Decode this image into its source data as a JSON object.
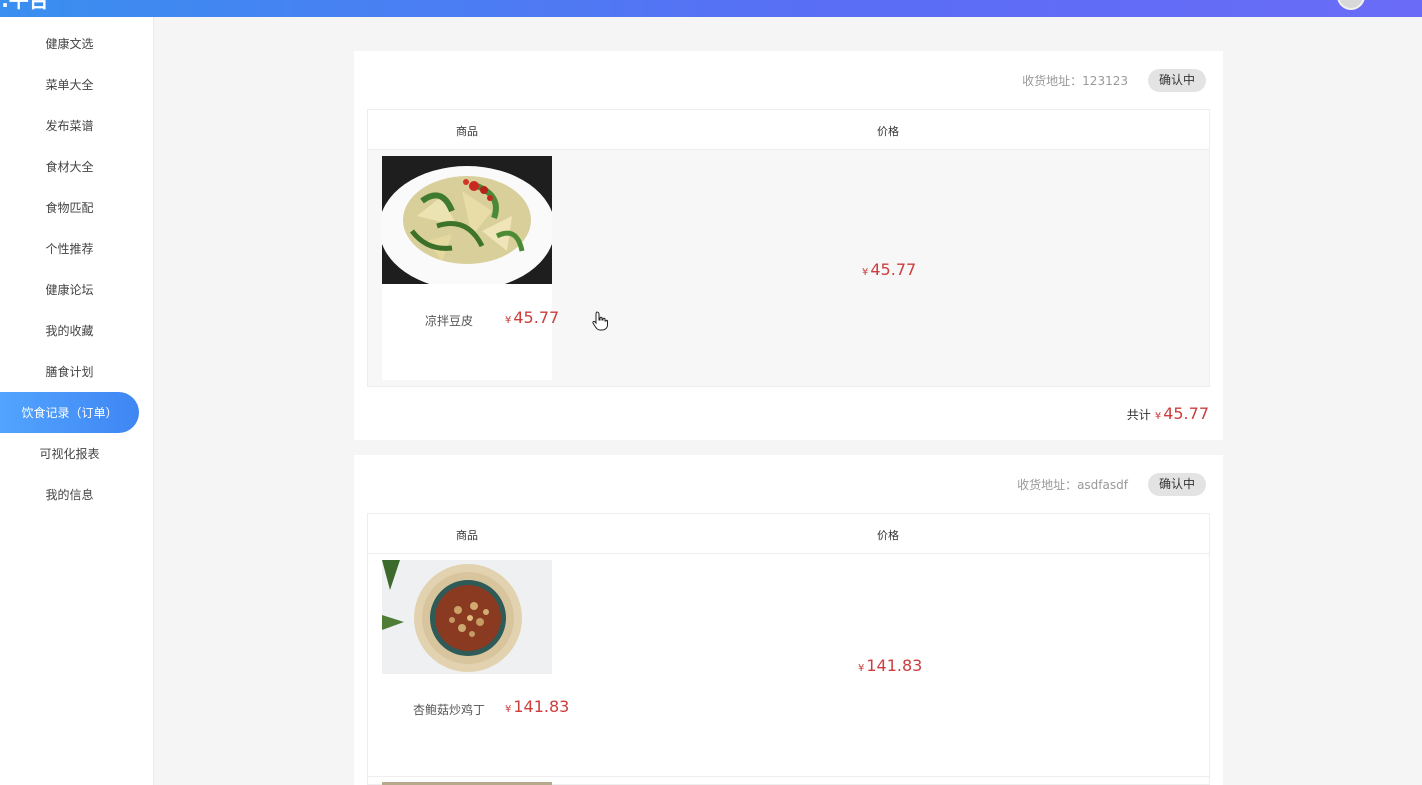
{
  "header": {
    "brand": "...平台"
  },
  "sidebar": {
    "items": [
      {
        "label": "健康文选"
      },
      {
        "label": "菜单大全"
      },
      {
        "label": "发布菜谱"
      },
      {
        "label": "食材大全"
      },
      {
        "label": "食物匹配"
      },
      {
        "label": "个性推荐"
      },
      {
        "label": "健康论坛"
      },
      {
        "label": "我的收藏"
      },
      {
        "label": "膳食计划"
      },
      {
        "label": "饮食记录（订单）",
        "active": true
      },
      {
        "label": "可视化报表"
      },
      {
        "label": "我的信息"
      }
    ]
  },
  "table_headers": {
    "product": "商品",
    "price": "价格"
  },
  "currency": "¥",
  "orders": [
    {
      "address": "收货地址：123123",
      "status": "确认中",
      "items": [
        {
          "name": "凉拌豆皮",
          "price": "45.77",
          "price_cell": "45.77",
          "image_icon": "cold-tofu-skin-dish"
        }
      ],
      "total_label": "共计",
      "total": "45.77"
    },
    {
      "address": "收货地址：asdfasdf",
      "status": "确认中",
      "items": [
        {
          "name": "杏鲍菇炒鸡丁",
          "price": "141.83",
          "price_cell": "141.83",
          "image_icon": "mushroom-chicken-dish"
        }
      ]
    }
  ],
  "colors": {
    "accent": "#3f86f3",
    "price": "#cc3d3d",
    "badge_bg": "#e3e3e3"
  }
}
